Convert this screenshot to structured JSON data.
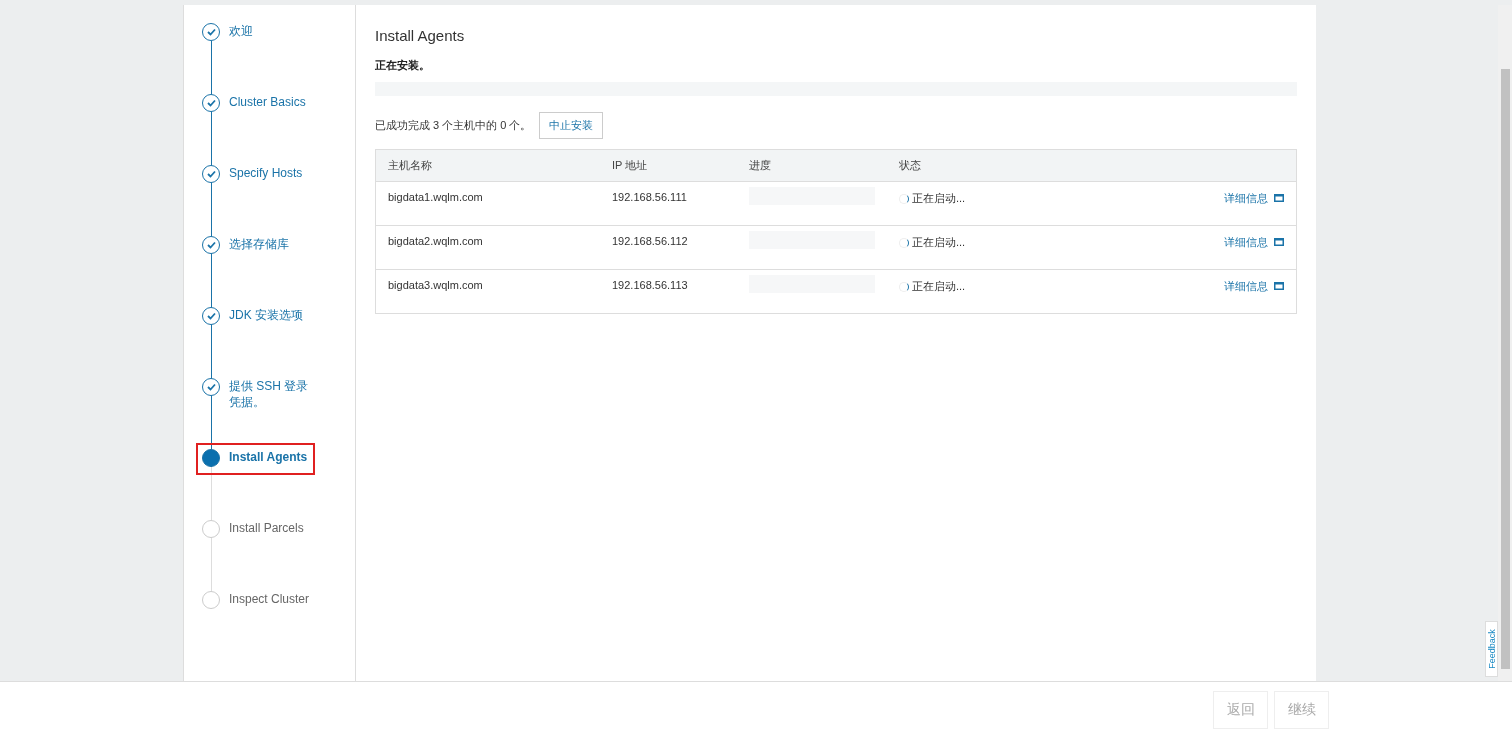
{
  "steps": [
    {
      "label": "欢迎",
      "done": true,
      "selected": false
    },
    {
      "label": "Cluster Basics",
      "done": true,
      "selected": false
    },
    {
      "label": "Specify Hosts",
      "done": true,
      "selected": false
    },
    {
      "label": "选择存储库",
      "done": true,
      "selected": false
    },
    {
      "label": "JDK 安装选项",
      "done": true,
      "selected": false
    },
    {
      "label": "提供 SSH 登录凭据。",
      "done": true,
      "selected": false
    },
    {
      "label": "Install Agents",
      "done": false,
      "selected": true
    },
    {
      "label": "Install Parcels",
      "done": false,
      "selected": false
    },
    {
      "label": "Inspect Cluster",
      "done": false,
      "selected": false
    }
  ],
  "page": {
    "title": "Install Agents",
    "subtitle": "正在安装。",
    "progress": {
      "level": 0
    },
    "summary": "已成功完成 3 个主机中的 0 个。",
    "abort_button": "中止安装"
  },
  "table": {
    "columns": [
      "主机名称",
      "IP 地址",
      "进度",
      "状态"
    ],
    "rows": [
      {
        "host": "bigdata1.wqlm.com",
        "ip": "192.168.56.111",
        "level": 0,
        "status": "正在启动...",
        "details": "详细信息"
      },
      {
        "host": "bigdata2.wqlm.com",
        "ip": "192.168.56.112",
        "level": 0,
        "status": "正在启动...",
        "details": "详细信息"
      },
      {
        "host": "bigdata3.wqlm.com",
        "ip": "192.168.56.113",
        "level": 0,
        "status": "正在启动...",
        "details": "详细信息"
      }
    ]
  },
  "feedback": "Feedback",
  "footer": {
    "buttons": [
      {
        "label": "返回",
        "disabled": true
      },
      {
        "label": "继续",
        "disabled": true
      }
    ]
  }
}
